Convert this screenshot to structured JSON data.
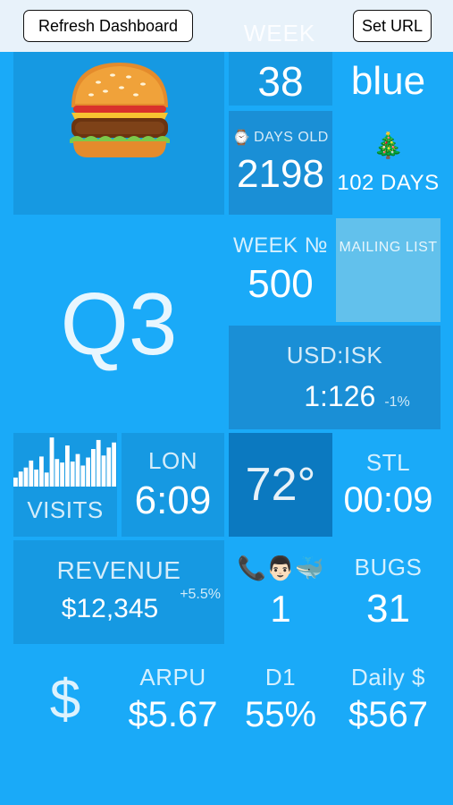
{
  "topbar": {
    "refresh_label": "Refresh Dashboard",
    "set_url_label": "Set URL",
    "ghost_text": "WEEK"
  },
  "tiles": {
    "week_number": "38",
    "color_word": "blue",
    "days_old": {
      "icon": "⌚",
      "label": "DAYS OLD",
      "value": "2198"
    },
    "xmas": {
      "icon": "🎄",
      "label": "102 DAYS"
    },
    "week_no": {
      "label": "WEEK №",
      "value": "500"
    },
    "mailing_list": {
      "label": "MAILING LIST"
    },
    "quarter": "Q3",
    "usd_isk": {
      "label": "USD:ISK",
      "value": "1:126",
      "change": "-1%"
    },
    "visits": {
      "label": "VISITS",
      "bars": [
        0.18,
        0.3,
        0.38,
        0.52,
        0.34,
        0.6,
        0.28,
        0.98,
        0.55,
        0.48,
        0.82,
        0.5,
        0.65,
        0.42,
        0.58,
        0.75,
        0.93,
        0.62,
        0.78,
        0.88
      ]
    },
    "lon": {
      "label": "LON",
      "value": "6:09"
    },
    "temp": "72°",
    "stl": {
      "label": "STL",
      "value": "00:09"
    },
    "revenue": {
      "label": "REVENUE",
      "value": "$12,345",
      "change": "+5.5%"
    },
    "phone_icons": {
      "icons": "📞👨🏻🐳",
      "value": "1"
    },
    "bugs": {
      "label": "BUGS",
      "value": "31"
    },
    "dollar_sign": "$",
    "arpu": {
      "label": "ARPU",
      "value": "$5.67"
    },
    "d1": {
      "label": "D1",
      "value": "55%"
    },
    "daily": {
      "label": "Daily $",
      "value": "$567"
    }
  },
  "colors": {
    "background": "#1aaaf8",
    "tile_dark": "#1699e2",
    "tile_darker": "#0b79c0",
    "tile_light": "#62c1ec"
  }
}
